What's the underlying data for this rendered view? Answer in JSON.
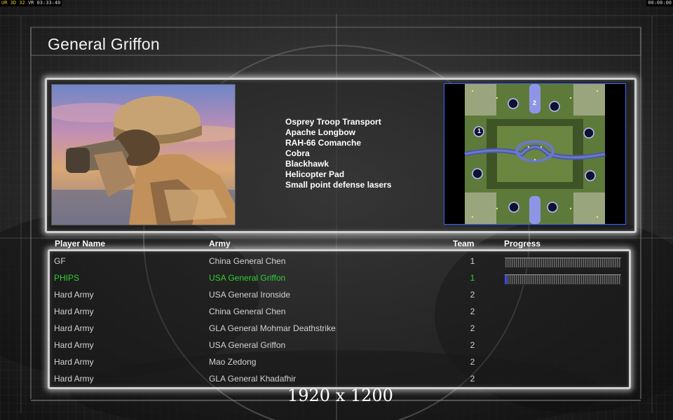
{
  "hud": {
    "left_flags": "UR 3D 32",
    "left_extra": "VR",
    "left_time": "03:33:40",
    "right_time": "00:00:00"
  },
  "title": "General Griffon",
  "units": [
    "Osprey Troop Transport",
    "Apache Longbow",
    "RAH-66 Comanche",
    "Cobra",
    "Blackhawk",
    "Helicopter Pad",
    "Small point defense lasers"
  ],
  "minimap": {
    "markers": [
      "2",
      "1"
    ]
  },
  "columns": {
    "player": "Player Name",
    "army": "Army",
    "team": "Team",
    "progress": "Progress"
  },
  "players": [
    {
      "name": "GF",
      "army": "China General Chen",
      "team": "1",
      "progress": 0,
      "local": false
    },
    {
      "name": "PHIPS",
      "army": "USA General Griffon",
      "team": "1",
      "progress": 0.02,
      "local": true
    },
    {
      "name": "Hard Army",
      "army": "USA General Ironside",
      "team": "2"
    },
    {
      "name": "Hard Army",
      "army": "China General Chen",
      "team": "2"
    },
    {
      "name": "Hard Army",
      "army": "GLA General Mohmar Deathstrike",
      "team": "2"
    },
    {
      "name": "Hard Army",
      "army": "USA General Griffon",
      "team": "2"
    },
    {
      "name": "Hard Army",
      "army": "Mao Zedong",
      "team": "2"
    },
    {
      "name": "Hard Army",
      "army": "GLA General Khadafhir",
      "team": "2"
    }
  ],
  "resolution": "1920 x 1200",
  "colors": {
    "local_player": "#2fd12f",
    "progress_fill": "#3a4bff",
    "minimap_border": "#3a63ff"
  }
}
